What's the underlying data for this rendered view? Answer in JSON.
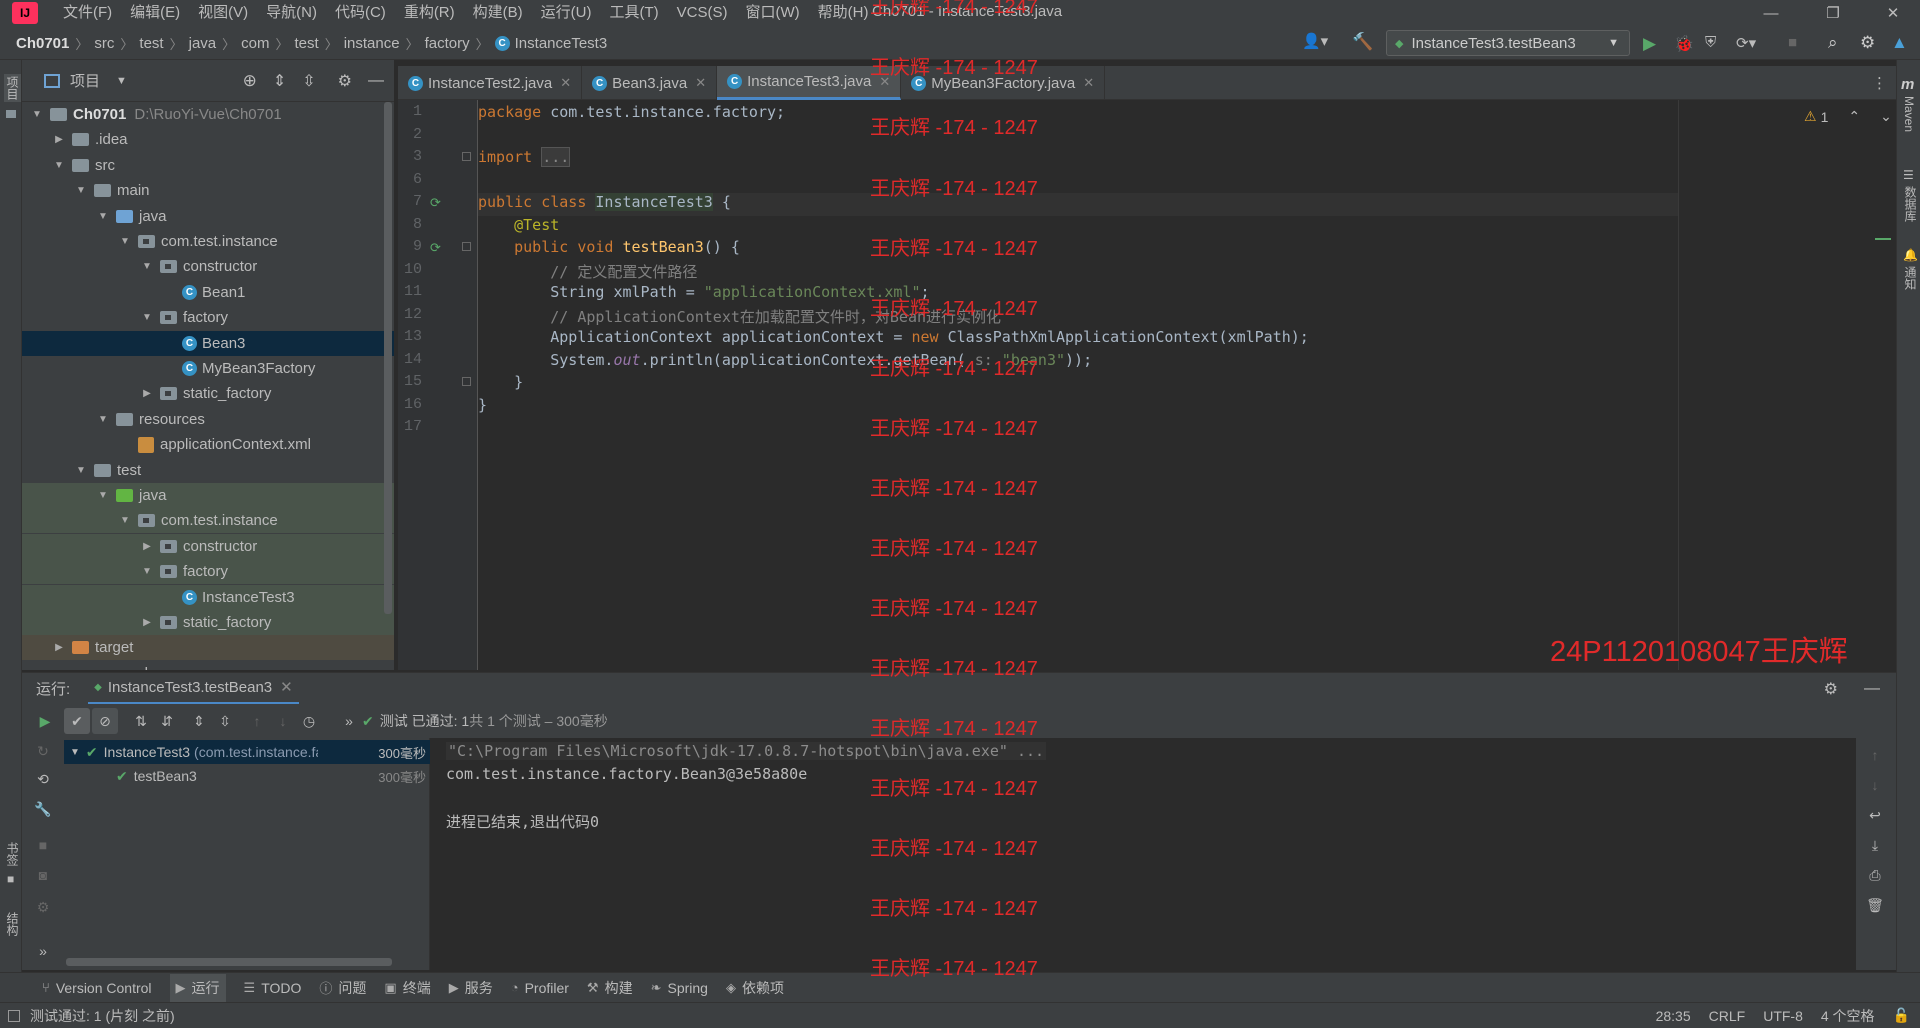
{
  "window": {
    "title": "Ch0701 - InstanceTest3.java"
  },
  "menu": [
    "文件(F)",
    "编辑(E)",
    "视图(V)",
    "导航(N)",
    "代码(C)",
    "重构(R)",
    "构建(B)",
    "运行(U)",
    "工具(T)",
    "VCS(S)",
    "窗口(W)",
    "帮助(H)"
  ],
  "breadcrumb": [
    "Ch0701",
    "src",
    "test",
    "java",
    "com",
    "test",
    "instance",
    "factory",
    "InstanceTest3"
  ],
  "run_config": "InstanceTest3.testBean3",
  "left_strip": {
    "project": "项目",
    "bookmarks": "书签",
    "structure": "结构"
  },
  "right_strip": {
    "maven": "Maven",
    "database": "数据库",
    "notifications": "通知"
  },
  "project_panel": {
    "title": "项目",
    "tree": [
      {
        "label": "Ch0701",
        "path": "D:\\RuoYi-Vue\\Ch0701",
        "indent": 0,
        "arrow": "down",
        "icon": "folder",
        "bold": true
      },
      {
        "label": ".idea",
        "indent": 1,
        "arrow": "right",
        "icon": "folder"
      },
      {
        "label": "src",
        "indent": 1,
        "arrow": "down",
        "icon": "folder"
      },
      {
        "label": "main",
        "indent": 2,
        "arrow": "down",
        "icon": "folder"
      },
      {
        "label": "java",
        "indent": 3,
        "arrow": "down",
        "icon": "folder-blue"
      },
      {
        "label": "com.test.instance",
        "indent": 4,
        "arrow": "down",
        "icon": "package"
      },
      {
        "label": "constructor",
        "indent": 5,
        "arrow": "down",
        "icon": "package"
      },
      {
        "label": "Bean1",
        "indent": 6,
        "arrow": "",
        "icon": "class"
      },
      {
        "label": "factory",
        "indent": 5,
        "arrow": "down",
        "icon": "package"
      },
      {
        "label": "Bean3",
        "indent": 6,
        "arrow": "",
        "icon": "class",
        "selected": true
      },
      {
        "label": "MyBean3Factory",
        "indent": 6,
        "arrow": "",
        "icon": "class"
      },
      {
        "label": "static_factory",
        "indent": 5,
        "arrow": "right",
        "icon": "package"
      },
      {
        "label": "resources",
        "indent": 3,
        "arrow": "down",
        "icon": "folder"
      },
      {
        "label": "applicationContext.xml",
        "indent": 4,
        "arrow": "",
        "icon": "xml"
      },
      {
        "label": "test",
        "indent": 2,
        "arrow": "down",
        "icon": "folder"
      },
      {
        "label": "java",
        "indent": 3,
        "arrow": "down",
        "icon": "folder-green",
        "test": true
      },
      {
        "label": "com.test.instance",
        "indent": 4,
        "arrow": "down",
        "icon": "package",
        "test": true
      },
      {
        "label": "constructor",
        "indent": 5,
        "arrow": "right",
        "icon": "package",
        "test": true
      },
      {
        "label": "factory",
        "indent": 5,
        "arrow": "down",
        "icon": "package",
        "test": true
      },
      {
        "label": "InstanceTest3",
        "indent": 6,
        "arrow": "",
        "icon": "class-test",
        "test": true
      },
      {
        "label": "static_factory",
        "indent": 5,
        "arrow": "right",
        "icon": "package",
        "test": true
      },
      {
        "label": "target",
        "indent": 1,
        "arrow": "right",
        "icon": "folder-orange",
        "excluded": true
      },
      {
        "label": "pom.xml",
        "indent": 1,
        "arrow": "",
        "icon": "maven"
      }
    ]
  },
  "tabs": [
    {
      "label": "InstanceTest2.java",
      "active": false
    },
    {
      "label": "Bean3.java",
      "active": false
    },
    {
      "label": "InstanceTest3.java",
      "active": true
    },
    {
      "label": "MyBean3Factory.java",
      "active": false
    }
  ],
  "editor": {
    "warnings": "1",
    "line_numbers": [
      "1",
      "2",
      "3",
      "6",
      "7",
      "8",
      "9",
      "10",
      "11",
      "12",
      "13",
      "14",
      "15",
      "16",
      "17"
    ],
    "lines": [
      [
        {
          "t": "package ",
          "c": "kw"
        },
        {
          "t": "com.test.instance.factory;",
          "c": ""
        }
      ],
      [],
      [
        {
          "t": "import ",
          "c": "kw"
        },
        {
          "t": "...",
          "c": "fold"
        }
      ],
      [],
      [
        {
          "t": "public class ",
          "c": "kw"
        },
        {
          "t": "InstanceTest3",
          "c": "cls"
        },
        {
          "t": " {",
          "c": ""
        }
      ],
      [
        {
          "t": "    "
        },
        {
          "t": "@Test",
          "c": "an"
        }
      ],
      [
        {
          "t": "    "
        },
        {
          "t": "public void ",
          "c": "kw"
        },
        {
          "t": "testBean3",
          "c": "fn"
        },
        {
          "t": "() {",
          "c": ""
        }
      ],
      [
        {
          "t": "        "
        },
        {
          "t": "// 定义配置文件路径",
          "c": "cm"
        }
      ],
      [
        {
          "t": "        String xmlPath = "
        },
        {
          "t": "\"applicationContext.xml\"",
          "c": "str"
        },
        {
          "t": ";"
        }
      ],
      [
        {
          "t": "        "
        },
        {
          "t": "// ApplicationContext在加载配置文件时，对Bean进行实例化",
          "c": "cm"
        }
      ],
      [
        {
          "t": "        ApplicationContext applicationContext = "
        },
        {
          "t": "new ",
          "c": "kw"
        },
        {
          "t": "ClassPathXmlApplicationContext(xmlPath);"
        }
      ],
      [
        {
          "t": "        System."
        },
        {
          "t": "out",
          "c": "it"
        },
        {
          "t": ".println(applicationContext.getBean( "
        },
        {
          "t": "s: ",
          "c": "cm"
        },
        {
          "t": "\"bean3\"",
          "c": "str"
        },
        {
          "t": "));"
        }
      ],
      [
        {
          "t": "    }"
        }
      ],
      [
        {
          "t": "}"
        }
      ],
      []
    ]
  },
  "watermark": {
    "text": "王庆辉 -174 - 1247",
    "signature": "24P1120108047王庆辉"
  },
  "run_panel": {
    "label": "运行:",
    "tab": "InstanceTest3.testBean3",
    "status": "测试 已通过: 1",
    "status_detail": "共 1 个测试 – 300毫秒",
    "tests": [
      {
        "name": "InstanceTest3",
        "detail": "(com.test.instance.fa",
        "time": "300毫秒"
      },
      {
        "name": "testBean3",
        "time": "300毫秒"
      }
    ],
    "console": [
      "\"C:\\Program Files\\Microsoft\\jdk-17.0.8.7-hotspot\\bin\\java.exe\" ...",
      "com.test.instance.factory.Bean3@3e58a80e",
      "",
      "进程已结束,退出代码0"
    ]
  },
  "bottom_tools": [
    "Version Control",
    "运行",
    "TODO",
    "问题",
    "终端",
    "服务",
    "Profiler",
    "构建",
    "Spring",
    "依赖项"
  ],
  "status_bar": {
    "message": "测试通过: 1 (片刻 之前)",
    "position": "28:35",
    "line_sep": "CRLF",
    "encoding": "UTF-8",
    "indent": "4 个空格"
  }
}
